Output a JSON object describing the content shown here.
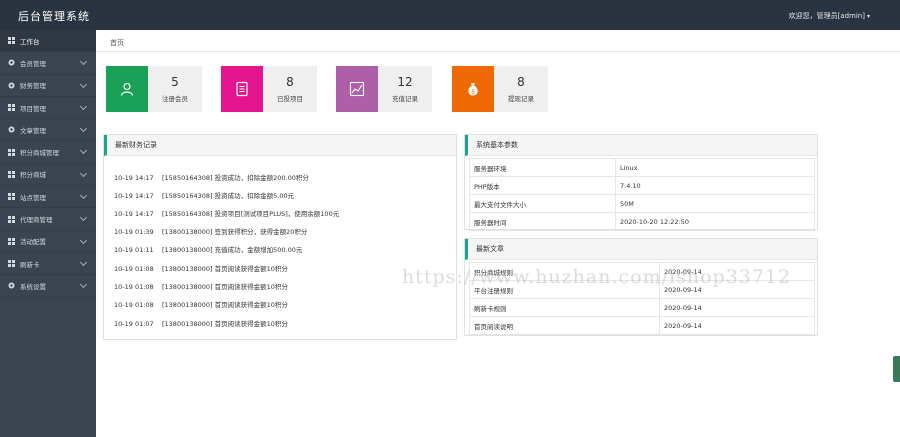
{
  "header": {
    "title": "后台管理系统",
    "user": "欢迎您，管理员[admin]"
  },
  "sidebar": {
    "items": [
      {
        "label": "工作台",
        "icon": "dashboard-icon",
        "expandable": false
      },
      {
        "label": "会员管理",
        "icon": "gear-icon",
        "expandable": true
      },
      {
        "label": "财务管理",
        "icon": "gear-icon",
        "expandable": true
      },
      {
        "label": "项目管理",
        "icon": "grid-icon",
        "expandable": true
      },
      {
        "label": "文章管理",
        "icon": "gear-icon",
        "expandable": true
      },
      {
        "label": "积分商城管理",
        "icon": "grid-icon",
        "expandable": true
      },
      {
        "label": "积分商城",
        "icon": "grid-icon",
        "expandable": true
      },
      {
        "label": "站点管理",
        "icon": "grid-icon",
        "expandable": true
      },
      {
        "label": "代理商管理",
        "icon": "grid-icon",
        "expandable": true
      },
      {
        "label": "活动配置",
        "icon": "grid-icon",
        "expandable": true
      },
      {
        "label": "刷新卡",
        "icon": "grid-icon",
        "expandable": true
      },
      {
        "label": "系统设置",
        "icon": "gear-icon",
        "expandable": true
      }
    ]
  },
  "breadcrumb": "首页",
  "stats": [
    {
      "value": "5",
      "label": "注册会员",
      "color": "#1aa157",
      "icon": "user-icon"
    },
    {
      "value": "8",
      "label": "已投项目",
      "color": "#e4158f",
      "icon": "document-icon"
    },
    {
      "value": "12",
      "label": "充值记录",
      "color": "#ad5fa8",
      "icon": "chart-icon"
    },
    {
      "value": "8",
      "label": "提现记录",
      "color": "#ef6a05",
      "icon": "money-bag-icon"
    }
  ],
  "finance": {
    "title": "最新财务记录",
    "rows": [
      {
        "time": "10-19 14:17",
        "text": "[15850164308] 投资成功，扣除金额200.00积分"
      },
      {
        "time": "10-19 14:17",
        "text": "[15850164308] 投资成功，扣除金额5.00元"
      },
      {
        "time": "10-19 14:17",
        "text": "[15850164308] 投资项目[测试项目PLUS]，使用余额100元"
      },
      {
        "time": "10-19 01:39",
        "text": "[13800138000] 签到获得积分，获得金额20积分"
      },
      {
        "time": "10-19 01:11",
        "text": "[13800138000] 充值成功，金额增加500.00元"
      },
      {
        "time": "10-19 01:08",
        "text": "[13800138000] 首页阅读获得金额10积分"
      },
      {
        "time": "10-19 01:08",
        "text": "[13800138000] 首页阅读获得金额10积分"
      },
      {
        "time": "10-19 01:08",
        "text": "[13800138000] 首页阅读获得金额10积分"
      },
      {
        "time": "10-19 01:07",
        "text": "[13800138000] 首页阅读获得金额10积分"
      }
    ]
  },
  "sysinfo": {
    "title": "系统基本参数",
    "rows": [
      {
        "k": "服务器环境",
        "v": "Linux"
      },
      {
        "k": "PHP版本",
        "v": "7.4.10"
      },
      {
        "k": "最大支付文件大小",
        "v": "50M"
      },
      {
        "k": "服务器时间",
        "v": "2020-10-20 12:22:50"
      }
    ]
  },
  "articles": {
    "title": "最新文章",
    "rows": [
      {
        "k": "积分商城规则",
        "v": "2020-09-14"
      },
      {
        "k": "平台注册规则",
        "v": "2020-09-14"
      },
      {
        "k": "刷新卡规则",
        "v": "2020-09-14"
      },
      {
        "k": "首页阅读说明",
        "v": "2020-09-14"
      }
    ]
  },
  "watermark": "https://www.huzhan.com/ishop33712"
}
